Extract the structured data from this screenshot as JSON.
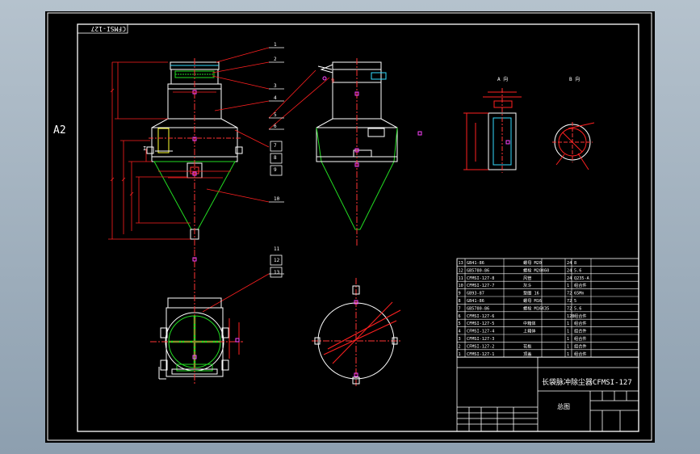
{
  "sheet": {
    "size_label": "A2",
    "drawing_code_stamp": "CFMSI-127"
  },
  "balloons": [
    "1",
    "2",
    "3",
    "4",
    "5",
    "6",
    "7",
    "8",
    "9",
    "10",
    "11",
    "12",
    "13"
  ],
  "section_labels": {
    "side_view_mark": "I",
    "view_a": "A 向",
    "view_b": "B 向"
  },
  "parts_list": {
    "rows": [
      {
        "no": "13",
        "code": "GB41-86",
        "name": "螺母 M20",
        "qty": "24",
        "note": "8"
      },
      {
        "no": "12",
        "code": "GB5780-86",
        "name": "螺栓 M20X60",
        "qty": "24",
        "note": "5.6"
      },
      {
        "no": "11",
        "code": "CFMSI-127-8",
        "name": "风管",
        "qty": "24",
        "note": "Q235-A"
      },
      {
        "no": "10",
        "code": "CFMSI-127-7",
        "name": "灰斗",
        "qty": "1",
        "note": "组合件"
      },
      {
        "no": "9",
        "code": "GB93-87",
        "name": "垫圈 16",
        "qty": "72",
        "note": "65Mn"
      },
      {
        "no": "8",
        "code": "GB41-86",
        "name": "螺母 M16",
        "qty": "72",
        "note": "5"
      },
      {
        "no": "7",
        "code": "GB5780-86",
        "name": "螺栓 M16X35",
        "qty": "72",
        "note": "5.6"
      },
      {
        "no": "6",
        "code": "CFMSI-127-6",
        "name": "",
        "qty": "128",
        "note": "组合件"
      },
      {
        "no": "5",
        "code": "CFMSI-127-5",
        "name": "中箱体",
        "qty": "1",
        "note": "组合件"
      },
      {
        "no": "4",
        "code": "CFMSI-127-4",
        "name": "上箱体",
        "qty": "1",
        "note": "组合件"
      },
      {
        "no": "3",
        "code": "CFMSI-127-3",
        "name": "",
        "qty": "1",
        "note": "组合件"
      },
      {
        "no": "2",
        "code": "CFMSI-127-2",
        "name": "花板",
        "qty": "1",
        "note": "组合件"
      },
      {
        "no": "1",
        "code": "CFMSI-127-1",
        "name": "顶盖",
        "qty": "1",
        "note": "组合件"
      }
    ]
  },
  "title_block": {
    "title": "长袋脉冲除尘器CFMSI-127",
    "subtitle": "总图"
  },
  "colors": {
    "outline": "#ffffff",
    "dimension": "#ff2020",
    "hopper": "#22dd22",
    "center_line": "#ff3333",
    "accent": "#ffff33",
    "cyan": "#33ddff",
    "magenta": "#ff44ff",
    "frame": "#ffffff"
  }
}
